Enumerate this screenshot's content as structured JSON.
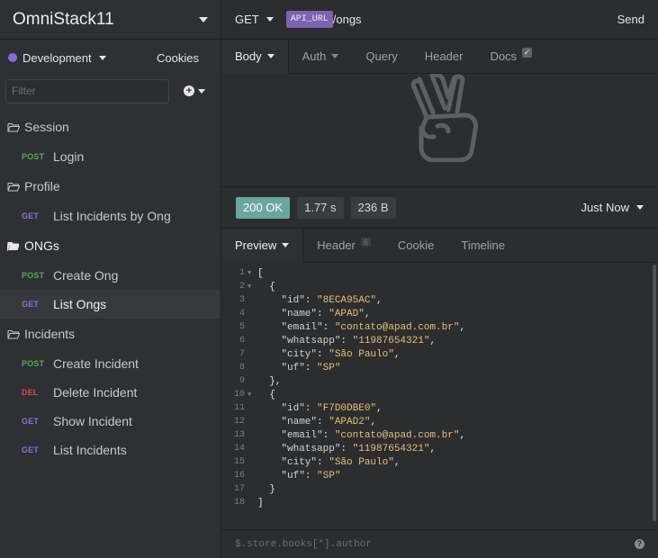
{
  "workspace": {
    "title": "OmniStack11"
  },
  "environment": {
    "name": "Development",
    "color": "#8a6ad8",
    "cookies_label": "Cookies"
  },
  "filter": {
    "placeholder": "Filter"
  },
  "tree": {
    "session": {
      "label": "Session"
    },
    "login": {
      "method": "POST",
      "label": "Login"
    },
    "profile": {
      "label": "Profile"
    },
    "list_incidents_by_ong": {
      "method": "GET",
      "label": "List Incidents by Ong"
    },
    "ongs": {
      "label": "ONGs"
    },
    "create_ong": {
      "method": "POST",
      "label": "Create Ong"
    },
    "list_ongs": {
      "method": "GET",
      "label": "List Ongs"
    },
    "incidents": {
      "label": "Incidents"
    },
    "create_incident": {
      "method": "POST",
      "label": "Create Incident"
    },
    "delete_incident": {
      "method": "DEL",
      "label": "Delete Incident"
    },
    "show_incident": {
      "method": "GET",
      "label": "Show Incident"
    },
    "list_incidents": {
      "method": "GET",
      "label": "List Incidents"
    }
  },
  "request": {
    "method": "GET",
    "url_var": "API_URL",
    "url_path": "/ongs",
    "send_label": "Send",
    "tabs": {
      "body": "Body",
      "auth": "Auth",
      "query": "Query",
      "header": "Header",
      "docs": "Docs"
    }
  },
  "response": {
    "status": "200 OK",
    "time": "1.77 s",
    "size": "236 B",
    "when": "Just Now",
    "tabs": {
      "preview": "Preview",
      "header": "Header",
      "header_count": "6",
      "cookie": "Cookie",
      "timeline": "Timeline"
    },
    "lines": {
      "l1": "1",
      "l2": "2",
      "l3": "3",
      "l4": "4",
      "l5": "5",
      "l6": "6",
      "l7": "7",
      "l8": "8",
      "l9": "9",
      "l10": "10",
      "l11": "11",
      "l12": "12",
      "l13": "13",
      "l14": "14",
      "l15": "15",
      "l16": "16",
      "l17": "17",
      "l18": "18"
    },
    "json": {
      "open_bracket": "[",
      "open_brace": "  {",
      "id_key": "\"id\"",
      "id1": "\"8ECA95AC\"",
      "name_key": "\"name\"",
      "name1": "\"APAD\"",
      "email_key": "\"email\"",
      "email1": "\"contato@apad.com.br\"",
      "whatsapp_key": "\"whatsapp\"",
      "whatsapp1": "\"11987654321\"",
      "city_key": "\"city\"",
      "city1": "\"São Paulo\"",
      "uf_key": "\"uf\"",
      "uf1": "\"SP\"",
      "close_brace_comma": "  },",
      "id2": "\"F7D0DBE0\"",
      "name2": "\"APAD2\"",
      "email2": "\"contato@apad.com.br\"",
      "whatsapp2": "\"11987654321\"",
      "city2": "\"São Paulo\"",
      "uf2": "\"SP\"",
      "close_brace": "  }",
      "close_bracket": "]"
    },
    "filter_placeholder": "$.store.books[*].author",
    "help_label": "?"
  }
}
